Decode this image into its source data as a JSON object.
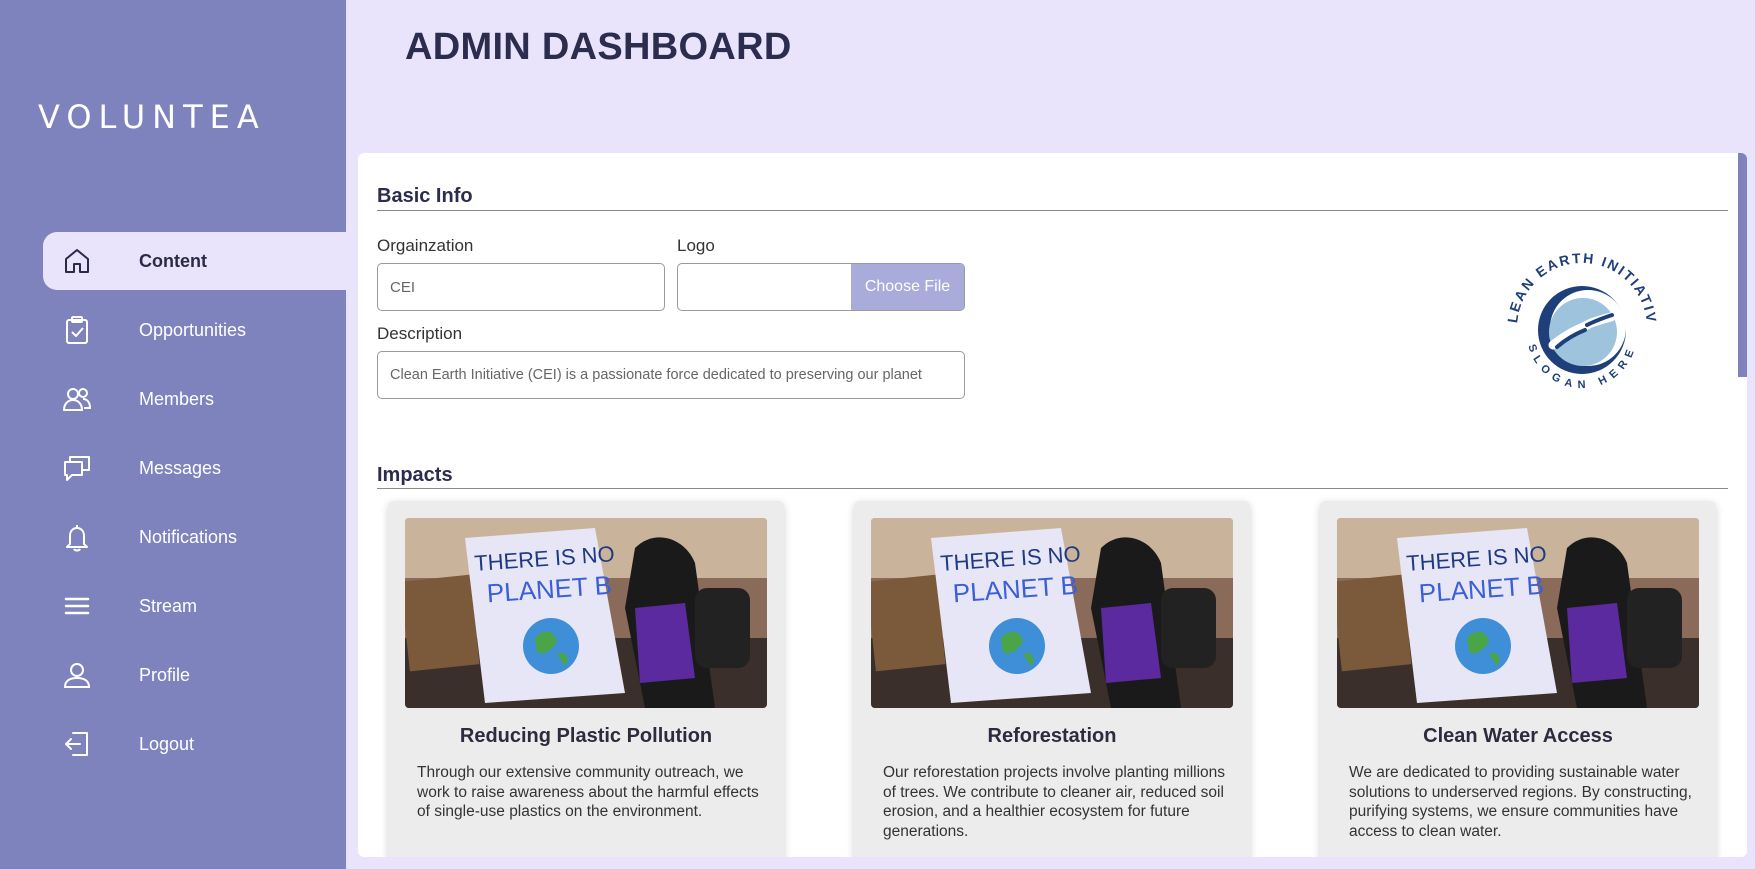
{
  "app": {
    "brand": "VOLUNTEA",
    "page_title": "ADMIN DASHBOARD"
  },
  "sidebar": {
    "items": [
      {
        "label": "Content",
        "icon": "home-icon",
        "active": true
      },
      {
        "label": "Opportunities",
        "icon": "clipboard-check-icon",
        "active": false
      },
      {
        "label": "Members",
        "icon": "members-icon",
        "active": false
      },
      {
        "label": "Messages",
        "icon": "messages-icon",
        "active": false
      },
      {
        "label": "Notifications",
        "icon": "bell-icon",
        "active": false
      },
      {
        "label": "Stream",
        "icon": "menu-icon",
        "active": false
      },
      {
        "label": "Profile",
        "icon": "user-icon",
        "active": false
      },
      {
        "label": "Logout",
        "icon": "logout-icon",
        "active": false
      }
    ]
  },
  "basic_info": {
    "title": "Basic Info",
    "organization_label": "Orgainzation",
    "organization_value": "CEI",
    "logo_label": "Logo",
    "choose_file_label": "Choose File",
    "description_label": "Description",
    "description_value": "Clean Earth Initiative (CEI) is a passionate force dedicated to preserving our planet",
    "logo_ring_top": "CLEAN EARTH INITIATIVE",
    "logo_ring_bottom": "SLOGAN HERE"
  },
  "impacts": {
    "title": "Impacts",
    "sign_line1": "THERE IS NO",
    "sign_line2": "PLANET B",
    "cards": [
      {
        "title": "Reducing Plastic Pollution",
        "text": "Through our extensive community outreach, we work to raise awareness about the harmful effects of single-use plastics on the environment."
      },
      {
        "title": "Reforestation",
        "text": "Our reforestation projects involve planting millions of trees. We contribute to cleaner air, reduced soil erosion, and a healthier ecosystem for future generations."
      },
      {
        "title": "Clean Water Access",
        "text": "We are dedicated to providing sustainable water solutions to underserved regions. By constructing, purifying systems, we ensure communities have access to clean water."
      }
    ]
  },
  "colors": {
    "sidebar": "#7f83bd",
    "background": "#e9e4fc",
    "accent": "#a9abda",
    "title": "#2c2c4e"
  }
}
